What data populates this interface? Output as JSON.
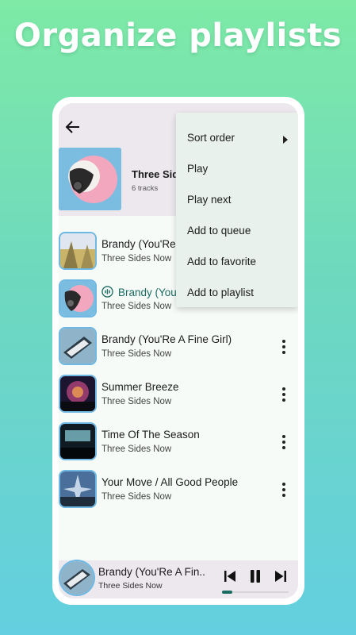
{
  "headline": "Organize playlists",
  "playlist": {
    "title": "Three Sides Now",
    "track_count": "6 tracks"
  },
  "menu": {
    "items": [
      "Sort order",
      "Play",
      "Play next",
      "Add to queue",
      "Add to favorite",
      "Add to playlist"
    ]
  },
  "tracks": [
    {
      "title": "Brandy (You'Re A Fine Girl)",
      "artist": "Three Sides Now",
      "playing": false
    },
    {
      "title": "Brandy (You'Re A Fine Girl)",
      "artist": "Three Sides Now",
      "playing": true
    },
    {
      "title": "Brandy (You'Re A Fine Girl)",
      "artist": "Three Sides Now",
      "playing": false
    },
    {
      "title": "Summer Breeze",
      "artist": "Three Sides Now",
      "playing": false
    },
    {
      "title": "Time Of The Season",
      "artist": "Three Sides Now",
      "playing": false
    },
    {
      "title": "Your Move / All Good People",
      "artist": "Three Sides Now",
      "playing": false
    }
  ],
  "now_playing": {
    "title": "Brandy (You'Re A Fin..",
    "artist": "Three Sides Now",
    "progress": 0.15
  },
  "colors": {
    "accent": "#1a6b62",
    "thumb_ring": "#6fb8e3",
    "menu_bg": "#e8f1ec"
  },
  "icons": {
    "back": "back-arrow-icon",
    "more": "more-vert-icon",
    "submenu": "caret-right-icon",
    "playing": "equalizer-icon",
    "previous": "skip-previous-icon",
    "pause": "pause-icon",
    "next": "skip-next-icon"
  }
}
